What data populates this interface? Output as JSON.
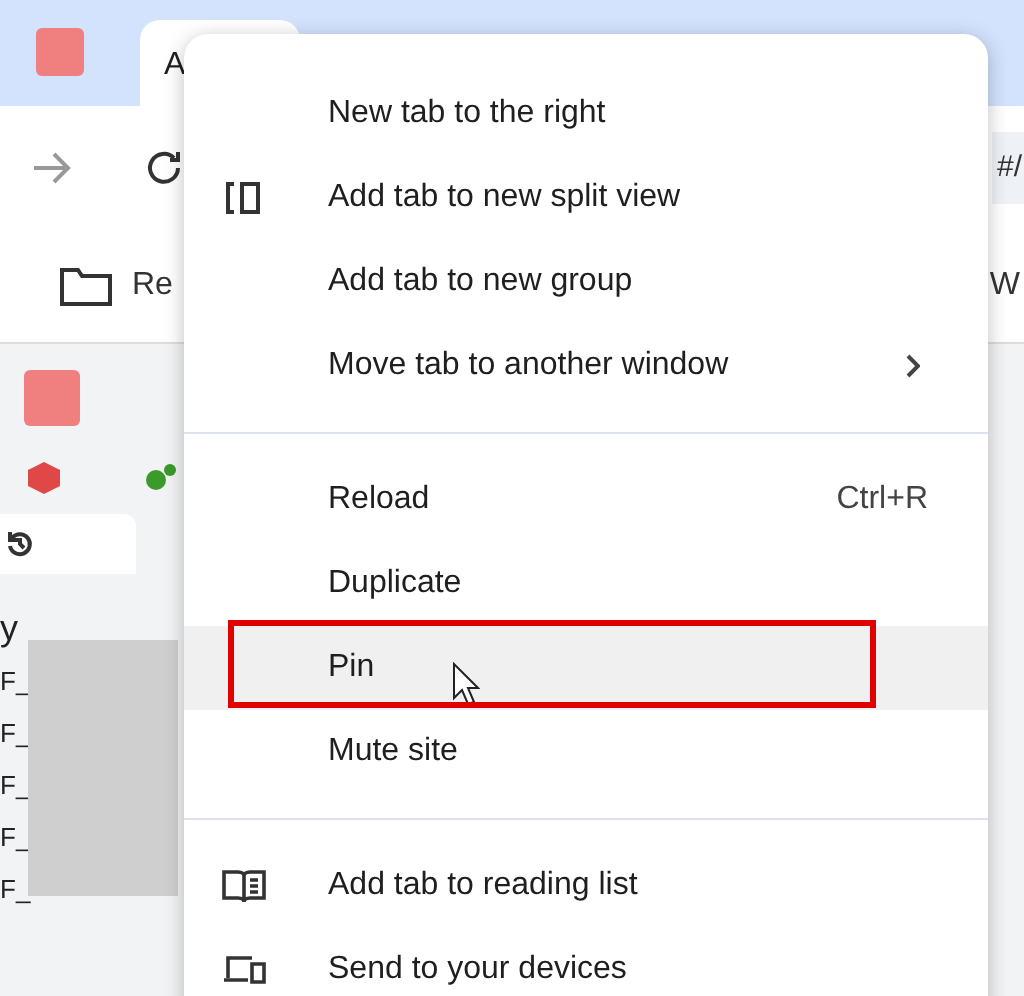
{
  "browser": {
    "active_tab": {
      "title": "A"
    },
    "address_bar": {
      "value": "#/"
    },
    "bookmarks": [
      {
        "label": "Re"
      },
      {
        "label": "W"
      }
    ],
    "page": {
      "heading": "y",
      "rows": [
        "F_",
        "F_",
        "F_",
        "F_",
        "F_"
      ]
    }
  },
  "context_menu": {
    "groups": [
      {
        "items": [
          {
            "label": "New tab to the right",
            "kind": "plain",
            "hovered": false,
            "annotated": false
          },
          {
            "label": "Add tab to new split view",
            "kind": "split",
            "hovered": false,
            "annotated": false
          },
          {
            "label": "Add tab to new group",
            "kind": "plain",
            "hovered": false,
            "annotated": false
          },
          {
            "label": "Move tab to another window",
            "kind": "submenu",
            "hovered": false,
            "annotated": false
          }
        ]
      },
      {
        "items": [
          {
            "label": "Reload",
            "kind": "plain",
            "shortcut": "Ctrl+R",
            "hovered": false,
            "annotated": false
          },
          {
            "label": "Duplicate",
            "kind": "plain",
            "hovered": false,
            "annotated": false
          },
          {
            "label": "Pin",
            "kind": "plain",
            "hovered": true,
            "annotated": true
          },
          {
            "label": "Mute site",
            "kind": "plain",
            "hovered": false,
            "annotated": false
          }
        ]
      },
      {
        "items": [
          {
            "label": "Add tab to reading list",
            "kind": "reading",
            "hovered": false,
            "annotated": false
          },
          {
            "label": "Send to your devices",
            "kind": "devices",
            "hovered": false,
            "annotated": false
          }
        ]
      }
    ]
  }
}
